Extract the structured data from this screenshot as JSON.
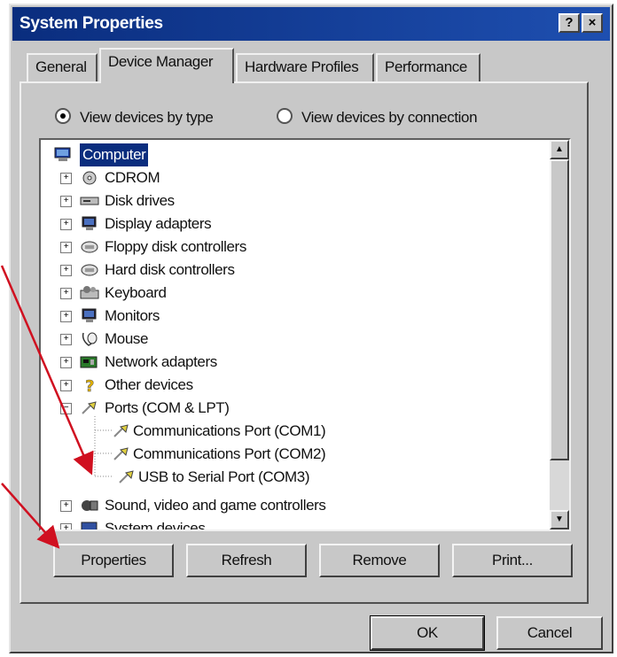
{
  "window": {
    "title": "System Properties",
    "help_btn": "?",
    "close_btn": "×"
  },
  "tabs": [
    "General",
    "Device Manager",
    "Hardware Profiles",
    "Performance"
  ],
  "radios": {
    "by_type": "View devices by type",
    "by_connection": "View devices by connection"
  },
  "tree": {
    "root": "Computer",
    "items": [
      "CDROM",
      "Disk drives",
      "Display adapters",
      "Floppy disk controllers",
      "Hard disk controllers",
      "Keyboard",
      "Monitors",
      "Mouse",
      "Network adapters",
      "Other devices",
      "Ports (COM & LPT)"
    ],
    "ports_children": [
      "Communications Port (COM1)",
      "Communications Port (COM2)",
      "USB to Serial Port (COM3)"
    ],
    "after": "Sound, video and game controllers",
    "partial": "System devices"
  },
  "buttons": {
    "properties": "Properties",
    "refresh": "Refresh",
    "remove": "Remove",
    "print": "Print...",
    "ok": "OK",
    "cancel": "Cancel"
  },
  "colors": {
    "title_bar": "#0a2d7e",
    "selection": "#0a2d7e",
    "face": "#c8c8c8",
    "arrow": "#d01020"
  }
}
